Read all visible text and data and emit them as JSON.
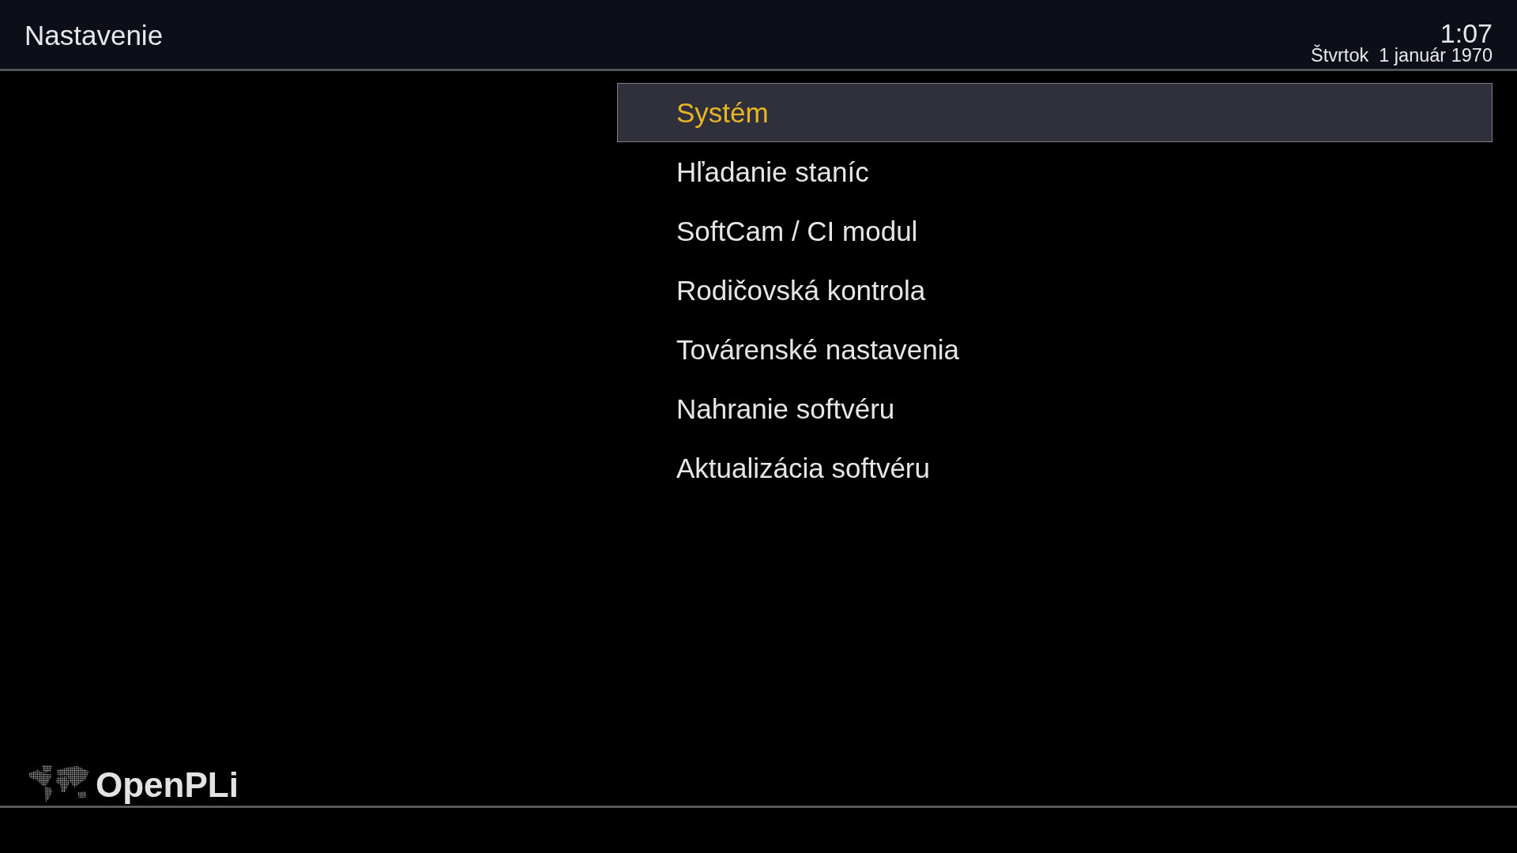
{
  "header": {
    "title": "Nastavenie",
    "time": "1:07",
    "date": "Štvrtok  1 január 1970"
  },
  "menu": {
    "items": [
      {
        "label": "Systém",
        "selected": true
      },
      {
        "label": "Hľadanie staníc",
        "selected": false
      },
      {
        "label": "SoftCam / CI modul",
        "selected": false
      },
      {
        "label": "Rodičovská kontrola",
        "selected": false
      },
      {
        "label": "Továrenské nastavenia",
        "selected": false
      },
      {
        "label": "Nahranie softvéru",
        "selected": false
      },
      {
        "label": "Aktualizácia softvéru",
        "selected": false
      }
    ]
  },
  "logo": {
    "text": "OpenPLi"
  }
}
